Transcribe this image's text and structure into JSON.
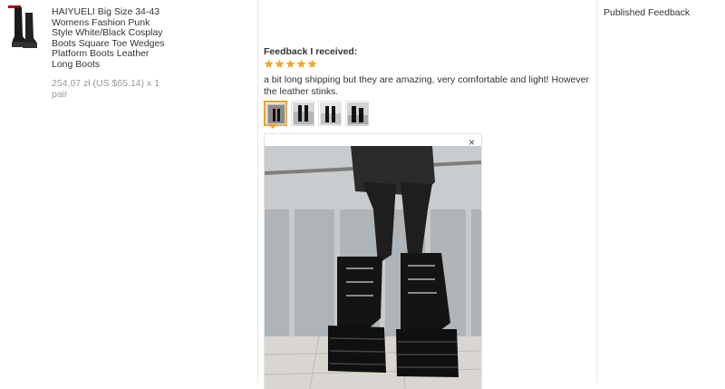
{
  "product": {
    "title": "HAIYUELI Big Size 34-43 Womens Fashion Punk Style White/Black Cosplay Boots Square Toe Wedges Platform Boots Leather Long Boots",
    "price": "254,07 zł (US $65.14) x 1 pair",
    "thumbnail_icon": "boot-product-image"
  },
  "feedback": {
    "heading": "Feedback I received:",
    "rating": 5,
    "star_color": "#f5a623",
    "text": "a bit long shipping but they are amazing, very comfortable and light! However the leather stinks.",
    "photo_count": 4,
    "selected_photo": 1
  },
  "viewer": {
    "close_label": "×"
  },
  "sidebar": {
    "published_label": "Published Feedback"
  }
}
